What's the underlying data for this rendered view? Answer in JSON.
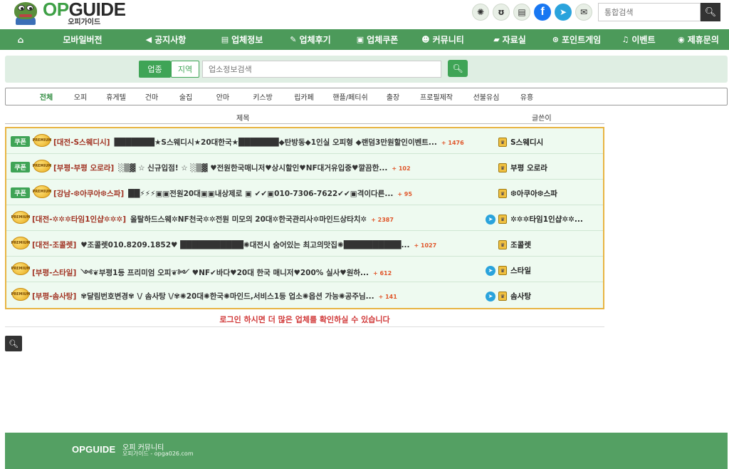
{
  "header": {
    "logo_main": "OPGUIDE",
    "logo_sub": "오피가이드",
    "search_placeholder": "통합검색",
    "social": [
      "party-icon",
      "bunny-icon",
      "kakao-story-icon",
      "facebook-icon",
      "telegram-icon",
      "mail-icon"
    ]
  },
  "nav": {
    "items": [
      {
        "label": "",
        "icon": "home-icon"
      },
      {
        "label": "모바일버전",
        "icon": ""
      },
      {
        "label": "공지사항",
        "icon": "megaphone-icon"
      },
      {
        "label": "업체정보",
        "icon": "list-icon"
      },
      {
        "label": "업체후기",
        "icon": "pencil-icon"
      },
      {
        "label": "업체쿠폰",
        "icon": "gift-icon"
      },
      {
        "label": "커뮤니티",
        "icon": "users-icon"
      },
      {
        "label": "자료실",
        "icon": "folder-icon"
      },
      {
        "label": "포인트게임",
        "icon": "gamepad-icon"
      },
      {
        "label": "이벤트",
        "icon": "bell-icon"
      },
      {
        "label": "제휴문의",
        "icon": "eye-icon"
      }
    ]
  },
  "filter": {
    "btn_type": "업종",
    "btn_region": "지역",
    "placeholder": "업소정보검색"
  },
  "categories": [
    "전체",
    "오피",
    "휴게텔",
    "건마",
    "술집",
    "안마",
    "키스방",
    "립카페",
    "핸플/페티쉬",
    "출장",
    "프로필제작",
    "선불유심",
    "유흥"
  ],
  "table": {
    "col_title": "제목",
    "col_writer": "글쓴이"
  },
  "rows": [
    {
      "coupon": "쿠폰",
      "loc": "[대전-S스웨디시]",
      "desc": "███████★S스웨디시★20대한국★███████◆탄방동◆1인실 오피형 ◆랜덤3만원할인이벤트...",
      "count": "+ 1476",
      "writer": "S스웨디시",
      "telegram": false
    },
    {
      "coupon": "쿠폰",
      "loc": "[부평-부평 오로라]",
      "desc": "░▒▓ ☆ 신규입점! ☆ ░▒▓ ♥전원한국매니저♥상시할인♥NF대거유입중♥깔끔한...",
      "count": "+ 102",
      "writer": "부평 오로라",
      "telegram": false
    },
    {
      "coupon": "쿠폰",
      "loc": "[강남-❆아쿠아❆스파]",
      "desc": "██⚡⚡⚡▣▣전원20대▣▣내상제로 ▣ ✔✔▣010-7306-7622✔✔▣격이다른...",
      "count": "+ 95",
      "writer": "❆아쿠아❆스파",
      "telegram": false
    },
    {
      "coupon": "",
      "loc": "[대전-✲✲✲타임1인샵✲✲✲]",
      "desc": "올탈하드스웨✲NF천국✲✲전원 미모의 20대✲한국관리사✲마인드상타치✲",
      "count": "+ 2387",
      "writer": "✲✲✲타임1인샵✲✲...",
      "telegram": true
    },
    {
      "coupon": "",
      "loc": "[대전-조콜렛]",
      "desc": "♥조콜렛010.8209.1852♥ ███████████✺대전시 숨어있는 최고의맛집✺██████████...",
      "count": "+ 1027",
      "writer": "조콜렛",
      "telegram": false
    },
    {
      "coupon": "",
      "loc": "[부평-스타일]",
      "desc": "༺❦부평1등 프리미엄 오피❦༻ ♥NF✔바다♥20대 한국 매니저♥200% 실사♥원하...",
      "count": "+ 612",
      "writer": "스타일",
      "telegram": true
    },
    {
      "coupon": "",
      "loc": "[부평-솜사탕]",
      "desc": "✾달림번호변경✾ \\/ 솜사탕 \\/✾✺20대✺한국✺마인드,서비스1등 업소✺옵션 가능✺공주님...",
      "count": "+ 141",
      "writer": "솜사탕",
      "telegram": true
    }
  ],
  "login_msg": "로그인 하시면 더 많은 업체를 확인하실 수 있습니다",
  "footer": {
    "logo": "OPGUIDE",
    "title": "오피 커뮤니티",
    "sub": "오피가이드 - opga026.com"
  },
  "colors": {
    "brand_green": "#4c9a5a",
    "accent_green": "#3fa456",
    "list_border": "#e8b443",
    "alert_red": "#d13a3a"
  }
}
